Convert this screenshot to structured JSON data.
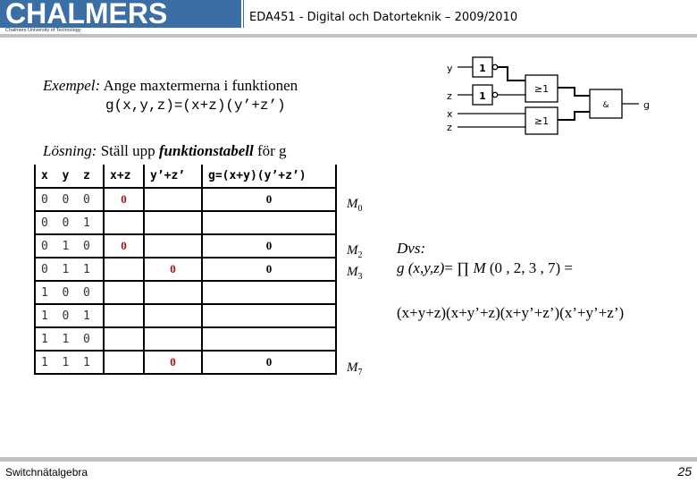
{
  "header": {
    "logo_text": "CHALMERS",
    "logo_subtitle": "Chalmers University of Technology",
    "course_title": "EDA451 - Digital och Datorteknik – 2009/2010"
  },
  "example": {
    "label": "Exempel:",
    "text": " Ange maxtermerna i funktionen",
    "formula": "g(x,y,z)=(x+z)(y’+z’)"
  },
  "circuit": {
    "inputs": [
      "y",
      "z",
      "x",
      "z"
    ],
    "not_gate_label": "1",
    "or_gate_label": "≥1",
    "and_gate_label": "&",
    "output": "g"
  },
  "solution": {
    "label": "Lösning:",
    "text1": " Ställ upp ",
    "bold": "funktionstabell",
    "text2": " för g"
  },
  "truth_table": {
    "headers": [
      "x  y  z",
      "x+z",
      "y’+z’",
      "g=(x+y)(y’+z’)"
    ],
    "rows": [
      {
        "xyz": "0  0  0",
        "xz": "0",
        "yz": "",
        "g": "0",
        "m": "M",
        "msub": "0"
      },
      {
        "xyz": "0  0  1",
        "xz": "",
        "yz": "",
        "g": "",
        "m": "",
        "msub": ""
      },
      {
        "xyz": "0  1  0",
        "xz": "0",
        "yz": "",
        "g": "0",
        "m": "M",
        "msub": "2"
      },
      {
        "xyz": "0  1  1",
        "xz": "",
        "yz": "0",
        "g": "0",
        "m": "M",
        "msub": "3"
      },
      {
        "xyz": "1  0  0",
        "xz": "",
        "yz": "",
        "g": "",
        "m": "",
        "msub": ""
      },
      {
        "xyz": "1  0  1",
        "xz": "",
        "yz": "",
        "g": "",
        "m": "",
        "msub": ""
      },
      {
        "xyz": "1  1  0",
        "xz": "",
        "yz": "",
        "g": "",
        "m": "",
        "msub": ""
      },
      {
        "xyz": "1  1  1",
        "xz": "",
        "yz": "0",
        "g": "0",
        "m": "M",
        "msub": "7"
      }
    ]
  },
  "conclusion": {
    "label": "Dvs:",
    "func": "g (x,y,z)",
    "eq": "= ∏ ",
    "m": "M",
    "list": " (0 , 2, 3 , 7) =",
    "expanded": "(x+y+z)(x+y’+z)(x+y’+z’)(x’+y’+z’)"
  },
  "footer": {
    "topic": "Switchnätalgebra",
    "page": "25"
  },
  "colors": {
    "brand_blue": "#3a6ea5",
    "highlight_red": "#a31515"
  }
}
